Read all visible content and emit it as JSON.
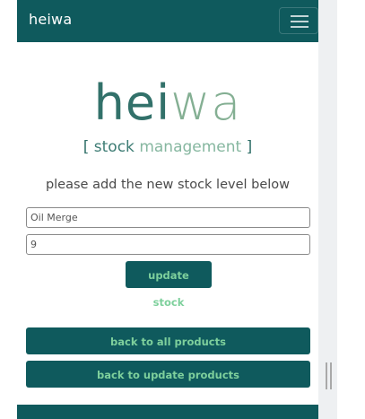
{
  "navbar": {
    "brand": "heiwa",
    "toggle_icon": "hamburger-menu-icon"
  },
  "logo": {
    "part1": "hei",
    "part2": "wa"
  },
  "subtitle": {
    "open_bracket": "[",
    "word1": "stock",
    "word2": "management",
    "close_bracket": "]"
  },
  "form": {
    "instruction": "please add the new stock level below",
    "product_value": "Oil Merge",
    "stock_value": "9",
    "update_label": "update stock"
  },
  "links": {
    "all_products": "back to all products",
    "update_products": "back to update products"
  },
  "colors": {
    "primary": "#0f5a5d",
    "button_text": "#7ed09c",
    "logo_dark": "#21655e",
    "logo_light": "#7aa98a"
  }
}
